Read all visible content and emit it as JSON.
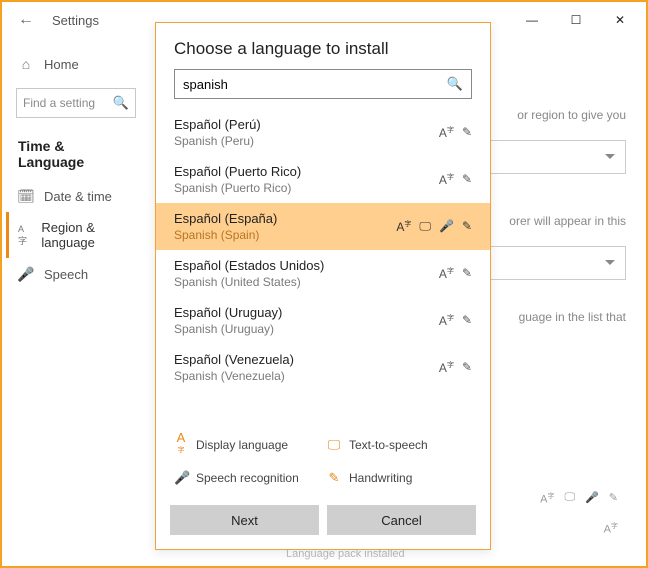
{
  "window": {
    "title": "Settings"
  },
  "sidebar": {
    "home": "Home",
    "find_placeholder": "Find a setting",
    "section": "Time & Language",
    "items": [
      {
        "label": "Date & time"
      },
      {
        "label": "Region & language"
      },
      {
        "label": "Speech"
      }
    ]
  },
  "main": {
    "hint1": "or region to give you",
    "hint2": "orer will appear in this",
    "hint3": "guage in the list that",
    "footer": "Language pack installed"
  },
  "dialog": {
    "title": "Choose a language to install",
    "search_value": "spanish",
    "languages": [
      {
        "native": "Español (Perú)",
        "english": "Spanish (Peru)",
        "features": [
          "at",
          "hw"
        ]
      },
      {
        "native": "Español (Puerto Rico)",
        "english": "Spanish (Puerto Rico)",
        "features": [
          "at",
          "hw"
        ]
      },
      {
        "native": "Español (España)",
        "english": "Spanish (Spain)",
        "features": [
          "at",
          "tts",
          "sr",
          "hw"
        ],
        "selected": true
      },
      {
        "native": "Español (Estados Unidos)",
        "english": "Spanish (United States)",
        "features": [
          "at",
          "hw"
        ]
      },
      {
        "native": "Español (Uruguay)",
        "english": "Spanish (Uruguay)",
        "features": [
          "at",
          "hw"
        ]
      },
      {
        "native": "Español (Venezuela)",
        "english": "Spanish (Venezuela)",
        "features": [
          "at",
          "hw"
        ]
      }
    ],
    "legend": {
      "display": "Display language",
      "tts": "Text-to-speech",
      "speech": "Speech recognition",
      "handwriting": "Handwriting"
    },
    "buttons": {
      "next": "Next",
      "cancel": "Cancel"
    }
  }
}
